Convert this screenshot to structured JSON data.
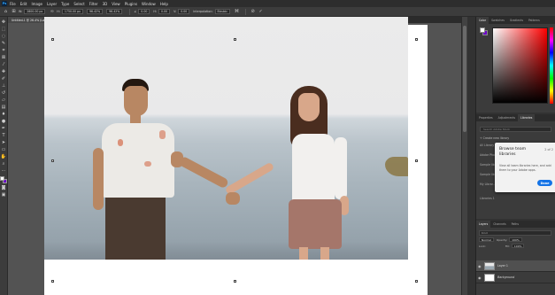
{
  "app": {
    "logo": "Ps"
  },
  "menu": [
    "File",
    "Edit",
    "Image",
    "Layer",
    "Type",
    "Select",
    "Filter",
    "3D",
    "View",
    "Plugins",
    "Window",
    "Help"
  ],
  "options": {
    "w_label": "W:",
    "w_value": "2800.00 px",
    "h_label": "H:",
    "h_value": "1750.00 px",
    "scale_value": "96.42%",
    "x_value": "96.42%",
    "angle_label": "∠",
    "angle_value": "0.00",
    "h_skew_label": "H:",
    "h_skew_value": "0.00",
    "v_skew_label": "V:",
    "v_skew_value": "0.00",
    "interp_label": "Interpolation:",
    "interp_value": "Bicubic"
  },
  "tabs": [
    {
      "label": "Untitled-1 @ 26.4% (Layer 1, RGB/8) *",
      "active": true
    },
    {
      "label": "pexels-wyndinta-1979075.jpg @ 25% (RGB/8)",
      "active": false
    }
  ],
  "panel": {
    "color_tabs": [
      "Color",
      "Swatches",
      "Gradients",
      "Patterns"
    ],
    "mid_tabs": [
      "Properties",
      "Adjustments",
      "Libraries"
    ],
    "libraries": {
      "search_placeholder": "Search Adobe Stock",
      "create_label": "+ Create new library",
      "items": [
        "All Library",
        "Adobe Pho...",
        "Sample lib...",
        "Sample lib...",
        "My Librar..."
      ],
      "footer": "Libraries 1"
    },
    "popover": {
      "title": "Browse team libraries",
      "count": "2 of 2",
      "body": "View all team libraries here, and add them to your Adobe apps.",
      "button": "Done"
    },
    "layers_tabs": [
      "Layers",
      "Channels",
      "Paths"
    ],
    "layers": {
      "filter_label": "Kind",
      "blend_mode": "Normal",
      "opacity_label": "Opacity:",
      "opacity_value": "100%",
      "lock_label": "Lock:",
      "fill_label": "Fill:",
      "fill_value": "100%",
      "rows": [
        {
          "name": "Layer 1",
          "active": true
        },
        {
          "name": "Background",
          "active": false
        }
      ]
    }
  },
  "colors": {
    "background": "#6a00c8",
    "accent": "#1473e6"
  }
}
